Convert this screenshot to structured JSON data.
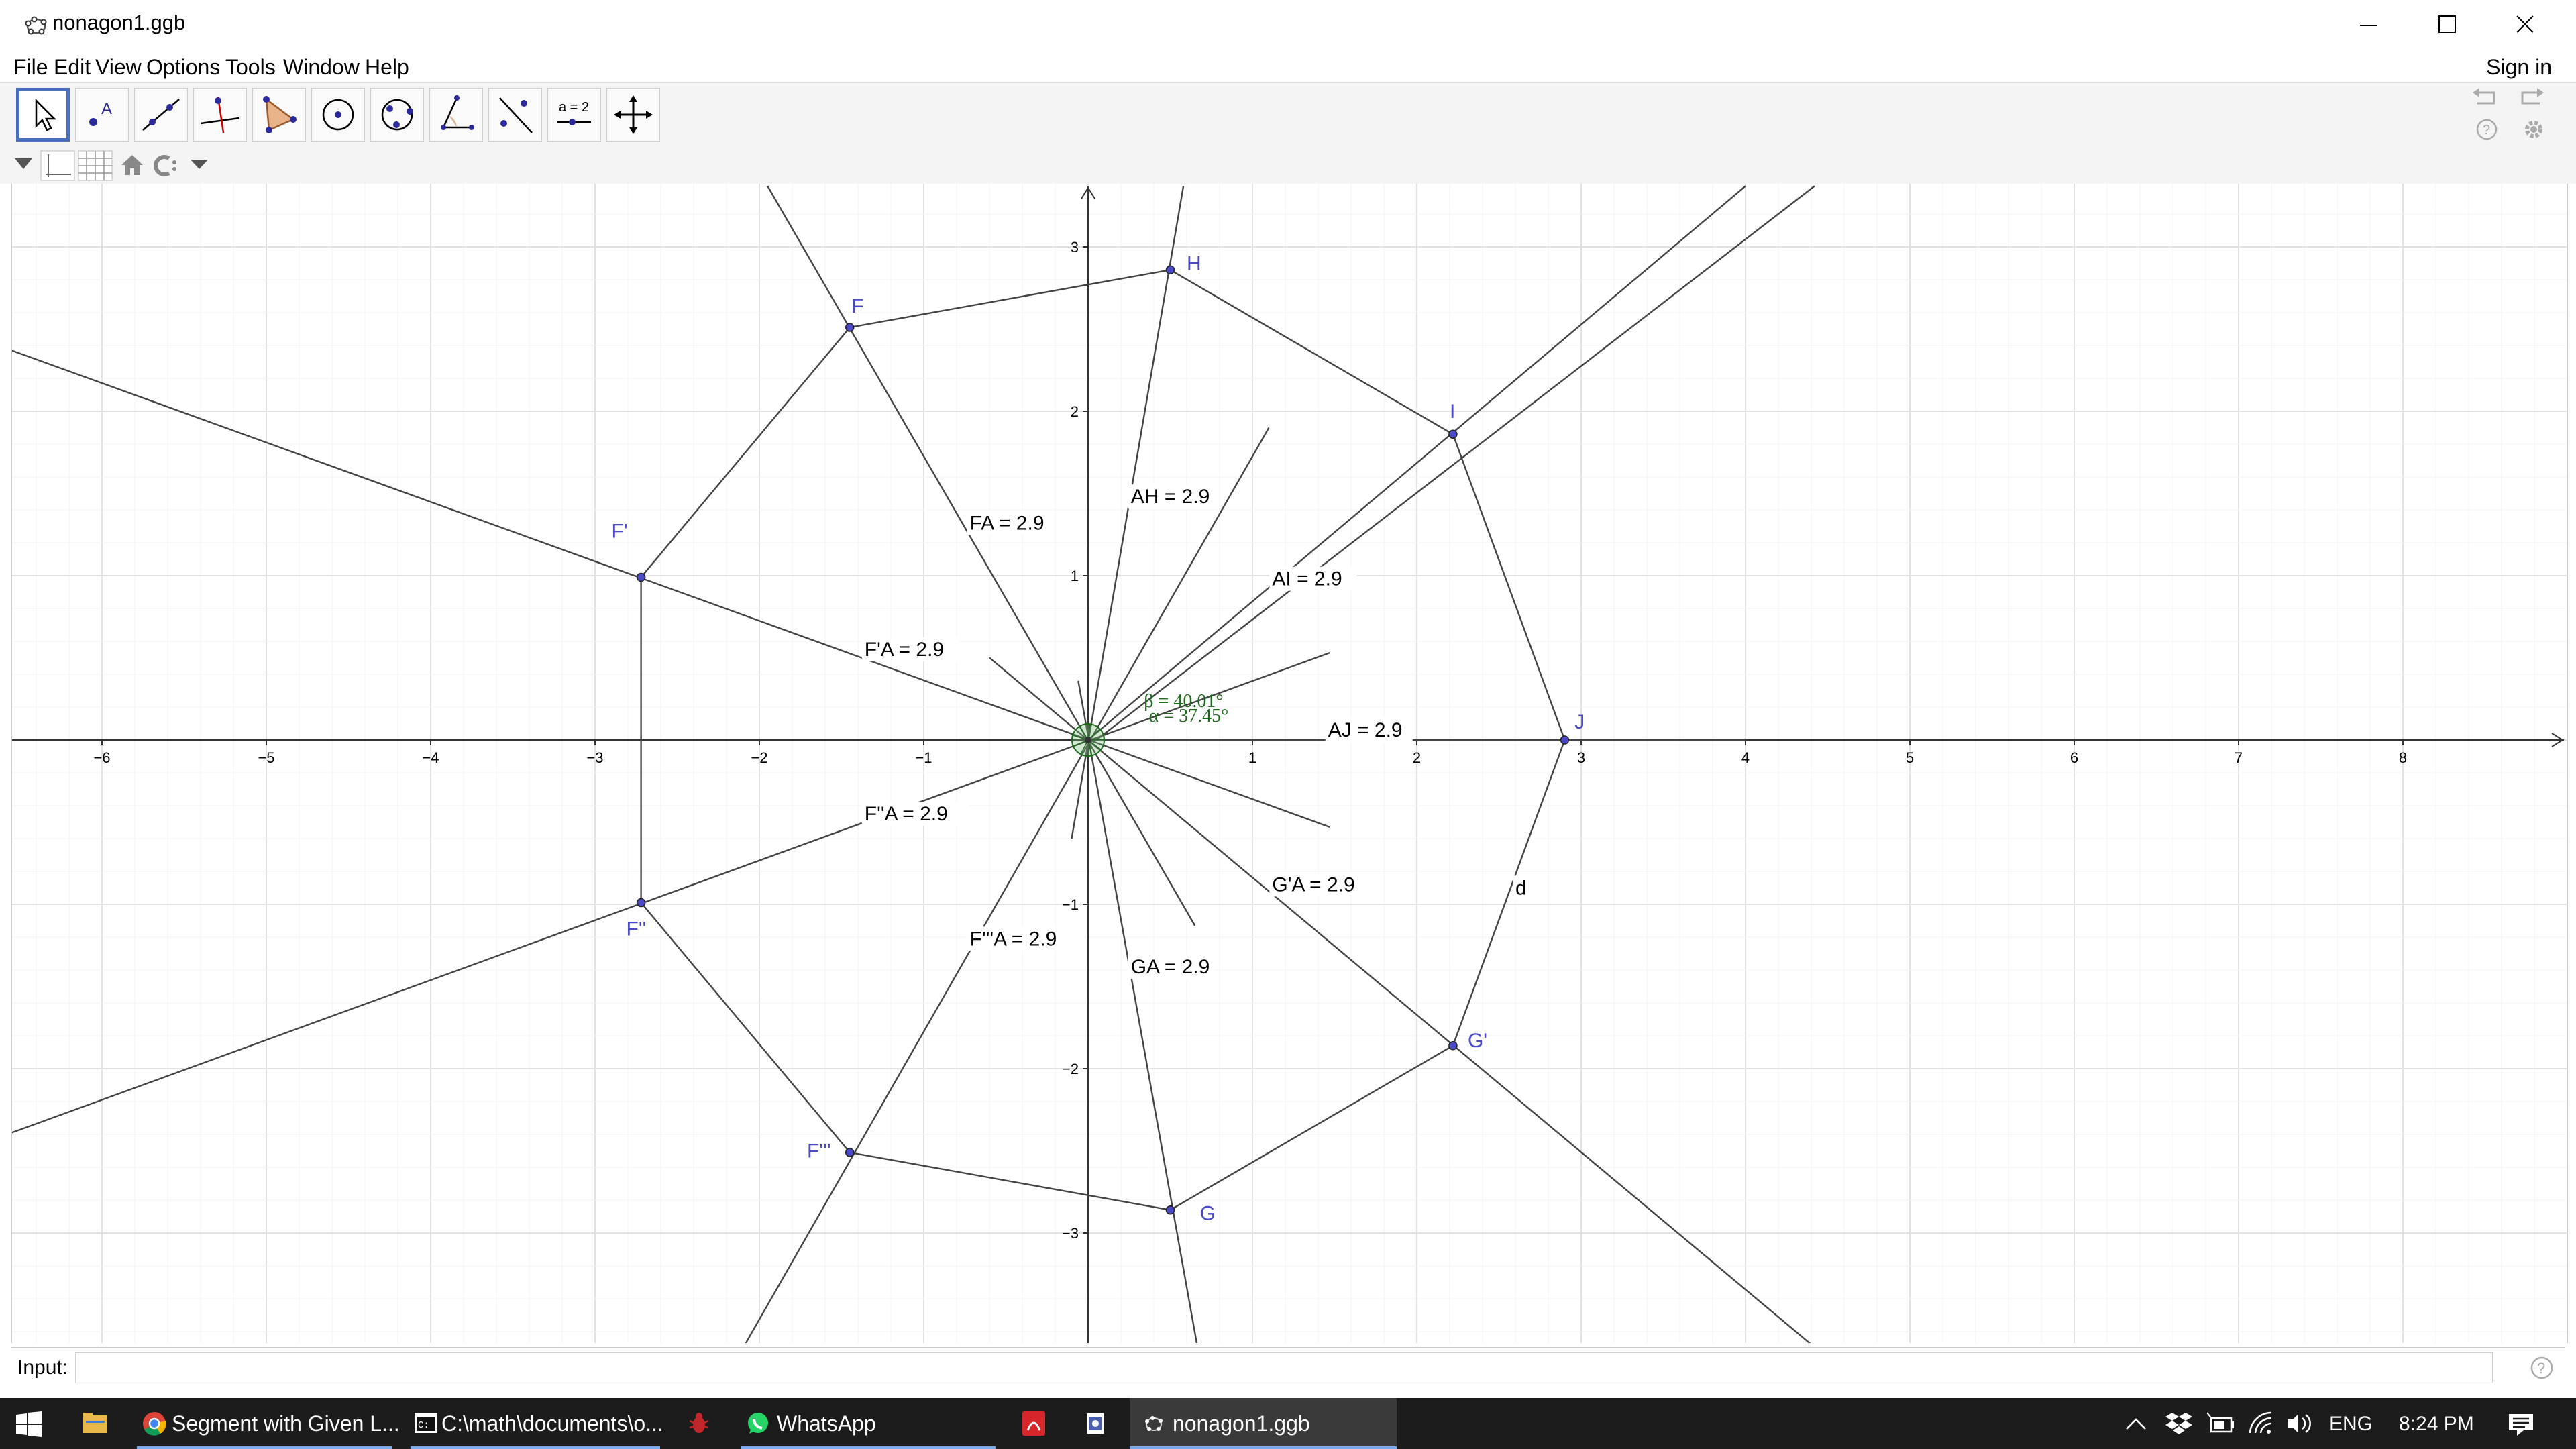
{
  "window": {
    "title": "nonagon1.ggb",
    "icon": "geogebra-logo-icon",
    "controls": [
      "minimize-icon",
      "maximize-icon",
      "close-icon"
    ]
  },
  "menu": {
    "items": [
      "File",
      "Edit",
      "View",
      "Options",
      "Tools",
      "Window",
      "Help"
    ],
    "sign_in": "Sign in"
  },
  "toolbar": {
    "tools": [
      "move-tool-icon",
      "point-tool-icon",
      "line-tool-icon",
      "perpendicular-line-tool-icon",
      "polygon-tool-icon",
      "circle-tool-icon",
      "ellipse-tool-icon",
      "angle-tool-icon",
      "reflect-tool-icon",
      "slider-tool-icon",
      "move-view-tool-icon"
    ],
    "slider_tool_text": "a = 2",
    "right_icons": [
      "undo-icon",
      "redo-icon",
      "help-icon",
      "gear-icon"
    ]
  },
  "stylebar": {
    "icons": [
      "toggle-stylebar-icon",
      "axes-toggle-icon",
      "grid-toggle-icon",
      "home-icon",
      "point-capture-icon",
      "dropdown-icon"
    ]
  },
  "graphics": {
    "x_ticks": [
      "−6",
      "−5",
      "−4",
      "−3",
      "−2",
      "−1",
      "1",
      "2",
      "3",
      "4",
      "5",
      "6",
      "7",
      "8"
    ],
    "y_ticks": [
      "3",
      "2",
      "1",
      "−1",
      "−2",
      "−3"
    ],
    "points": {
      "F": "F",
      "F1": "F'",
      "F2": "F''",
      "F3": "F'''",
      "G": "G",
      "G1": "G'",
      "H": "H",
      "I": "I",
      "J": "J"
    },
    "segment_labels": {
      "FA": "FA = 2.9",
      "F1A": "F'A = 2.9",
      "F2A": "F''A = 2.9",
      "F3A": "F'''A = 2.9",
      "GA": "GA = 2.9",
      "G1A": "G'A = 2.9",
      "AH": "AH = 2.9",
      "AI": "AI = 2.9",
      "AJ": "AJ = 2.9",
      "d": "d"
    },
    "angles": {
      "beta": "β = 40.01°",
      "alpha": "α = 37.45°"
    }
  },
  "input_bar": {
    "label": "Input:",
    "value": ""
  },
  "taskbar": {
    "start_icon": "windows-start-icon",
    "items": [
      {
        "icon": "file-explorer-icon",
        "label": ""
      },
      {
        "icon": "chrome-icon",
        "label": "Segment with Given L..."
      },
      {
        "icon": "command-prompt-icon",
        "label": "C:\\math\\documents\\o..."
      },
      {
        "icon": "bug-app-icon",
        "label": ""
      },
      {
        "icon": "whatsapp-icon",
        "label": "WhatsApp"
      },
      {
        "icon": "pdf-icon",
        "label": ""
      },
      {
        "icon": "app-icon",
        "label": ""
      },
      {
        "icon": "geogebra-icon",
        "label": "nonagon1.ggb"
      }
    ],
    "tray": {
      "icons": [
        "chevron-up-icon",
        "dropbox-icon",
        "battery-icon",
        "wifi-icon",
        "volume-icon"
      ],
      "language": "ENG",
      "time": "8:24 PM",
      "notification_icon": "action-center-icon"
    }
  },
  "colors": {
    "point": "#4a4ac8",
    "angle": "#1e6b1e",
    "grid": "#e2e2e2",
    "selected_tool": "#4a6fc0"
  }
}
